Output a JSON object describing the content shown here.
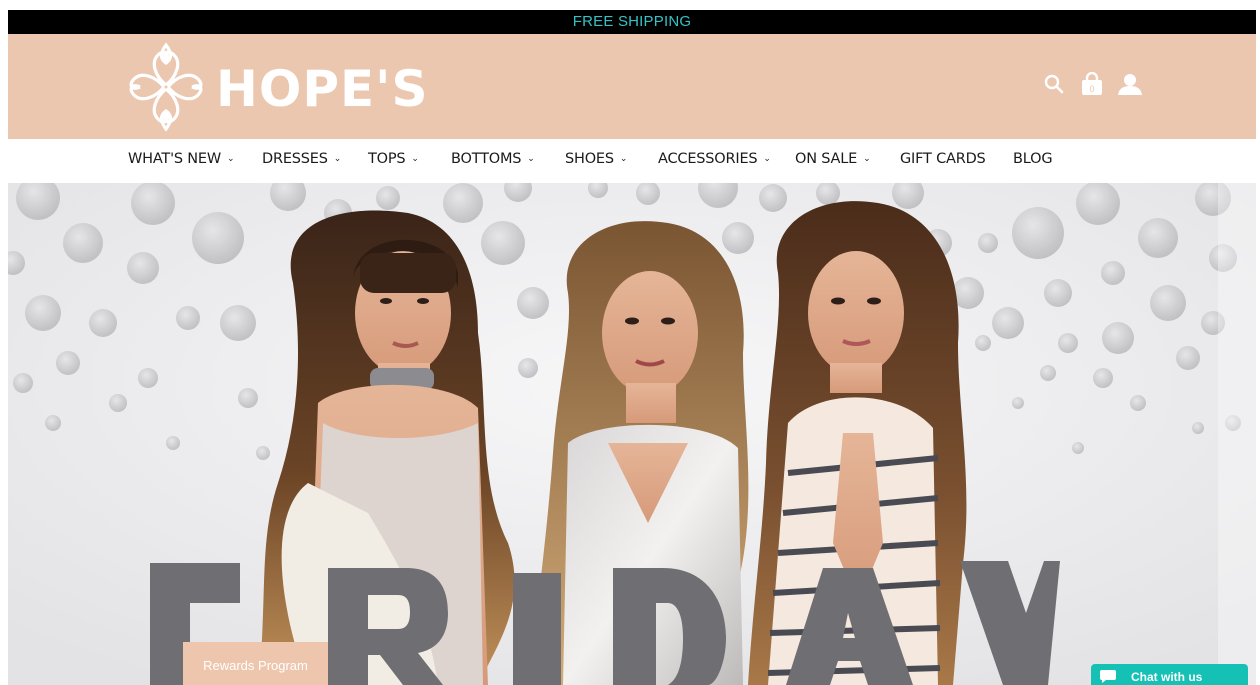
{
  "announcement": {
    "text": "FREE SHIPPING",
    "color": "#36c2c5"
  },
  "brand": {
    "name": "HOPE'S",
    "header_color": "#ecc7b0"
  },
  "header_icons": [
    {
      "icon": "search-icon"
    },
    {
      "icon": "cart-icon",
      "count": "0"
    },
    {
      "icon": "account-icon"
    }
  ],
  "nav": {
    "items": [
      {
        "label": "WHAT'S NEW",
        "dropdown": true
      },
      {
        "label": "DRESSES",
        "dropdown": true
      },
      {
        "label": "TOPS",
        "dropdown": true
      },
      {
        "label": "BOTTOMS",
        "dropdown": true
      },
      {
        "label": "SHOES",
        "dropdown": true
      },
      {
        "label": "ACCESSORIES",
        "dropdown": true
      },
      {
        "label": "ON SALE",
        "dropdown": true
      },
      {
        "label": "GIFT CARDS",
        "dropdown": false
      },
      {
        "label": "BLOG",
        "dropdown": false
      }
    ],
    "caret": "⌄"
  },
  "hero": {
    "headline": "FRIDAY",
    "headline_color": "#6f6e72"
  },
  "rewards": {
    "label": "Rewards Program",
    "color": "#eec6ad"
  },
  "chat": {
    "label": "Chat with us",
    "color": "#14c1b4"
  }
}
